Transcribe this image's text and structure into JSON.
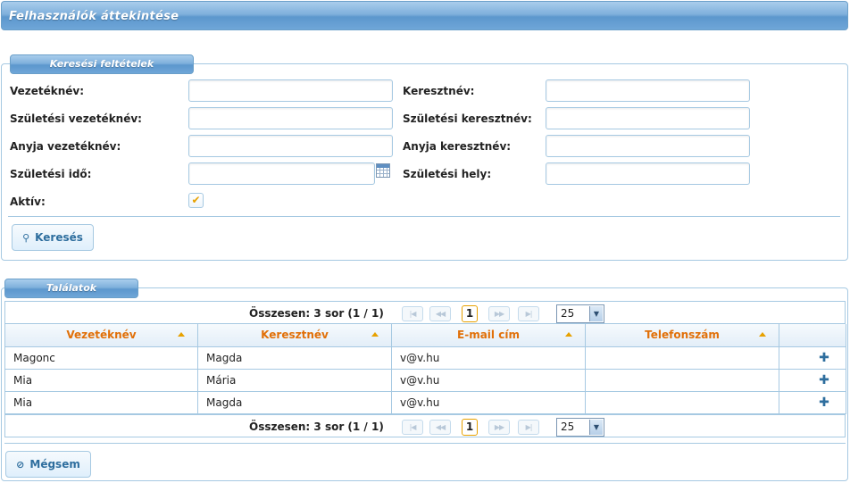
{
  "page": {
    "title": "Felhasználók áttekintése"
  },
  "search": {
    "legend": "Keresési feltételek",
    "fields": {
      "last_name": {
        "label": "Vezetéknév:",
        "value": ""
      },
      "first_name": {
        "label": "Keresztnév:",
        "value": ""
      },
      "birth_last_name": {
        "label": "Születési vezetéknév:",
        "value": ""
      },
      "birth_first_name": {
        "label": "Születési keresztnév:",
        "value": ""
      },
      "mother_last_name": {
        "label": "Anyja vezetéknév:",
        "value": ""
      },
      "mother_first_name": {
        "label": "Anyja keresztnév:",
        "value": ""
      },
      "birth_date": {
        "label": "Születési idő:",
        "value": ""
      },
      "birth_place": {
        "label": "Születési hely:",
        "value": ""
      },
      "active": {
        "label": "Aktív:",
        "checked": true,
        "mark": "✔"
      }
    },
    "search_button": {
      "label": "Keresés",
      "icon": "search-icon",
      "glyph": "⚲"
    }
  },
  "results": {
    "legend": "Találatok",
    "pager": {
      "summary": "Összesen: 3 sor (1 / 1)",
      "first": "|◀",
      "prev": "◀◀",
      "current_page": "1",
      "next": "▶▶",
      "last": "▶|",
      "page_size": "25",
      "dropdown_glyph": "▼"
    },
    "columns": [
      "Vezetéknév",
      "Keresztnév",
      "E-mail cím",
      "Telefonszám"
    ],
    "rows": [
      {
        "last_name": "Magonc",
        "first_name": "Magda",
        "email": "v@v.hu",
        "phone": "",
        "action": "✚"
      },
      {
        "last_name": "Mia",
        "first_name": "Mária",
        "email": "v@v.hu",
        "phone": "",
        "action": "✚"
      },
      {
        "last_name": "Mia",
        "first_name": "Magda",
        "email": "v@v.hu",
        "phone": "",
        "action": "✚"
      }
    ]
  },
  "footer": {
    "cancel_button": {
      "label": "Mégsem",
      "icon": "cancel-icon",
      "glyph": "⊘"
    }
  },
  "colors": {
    "header_blue": "#5c97cd",
    "border_blue": "#a6c9e2",
    "sort_orange": "#e17009",
    "button_text": "#2e6e9e"
  }
}
